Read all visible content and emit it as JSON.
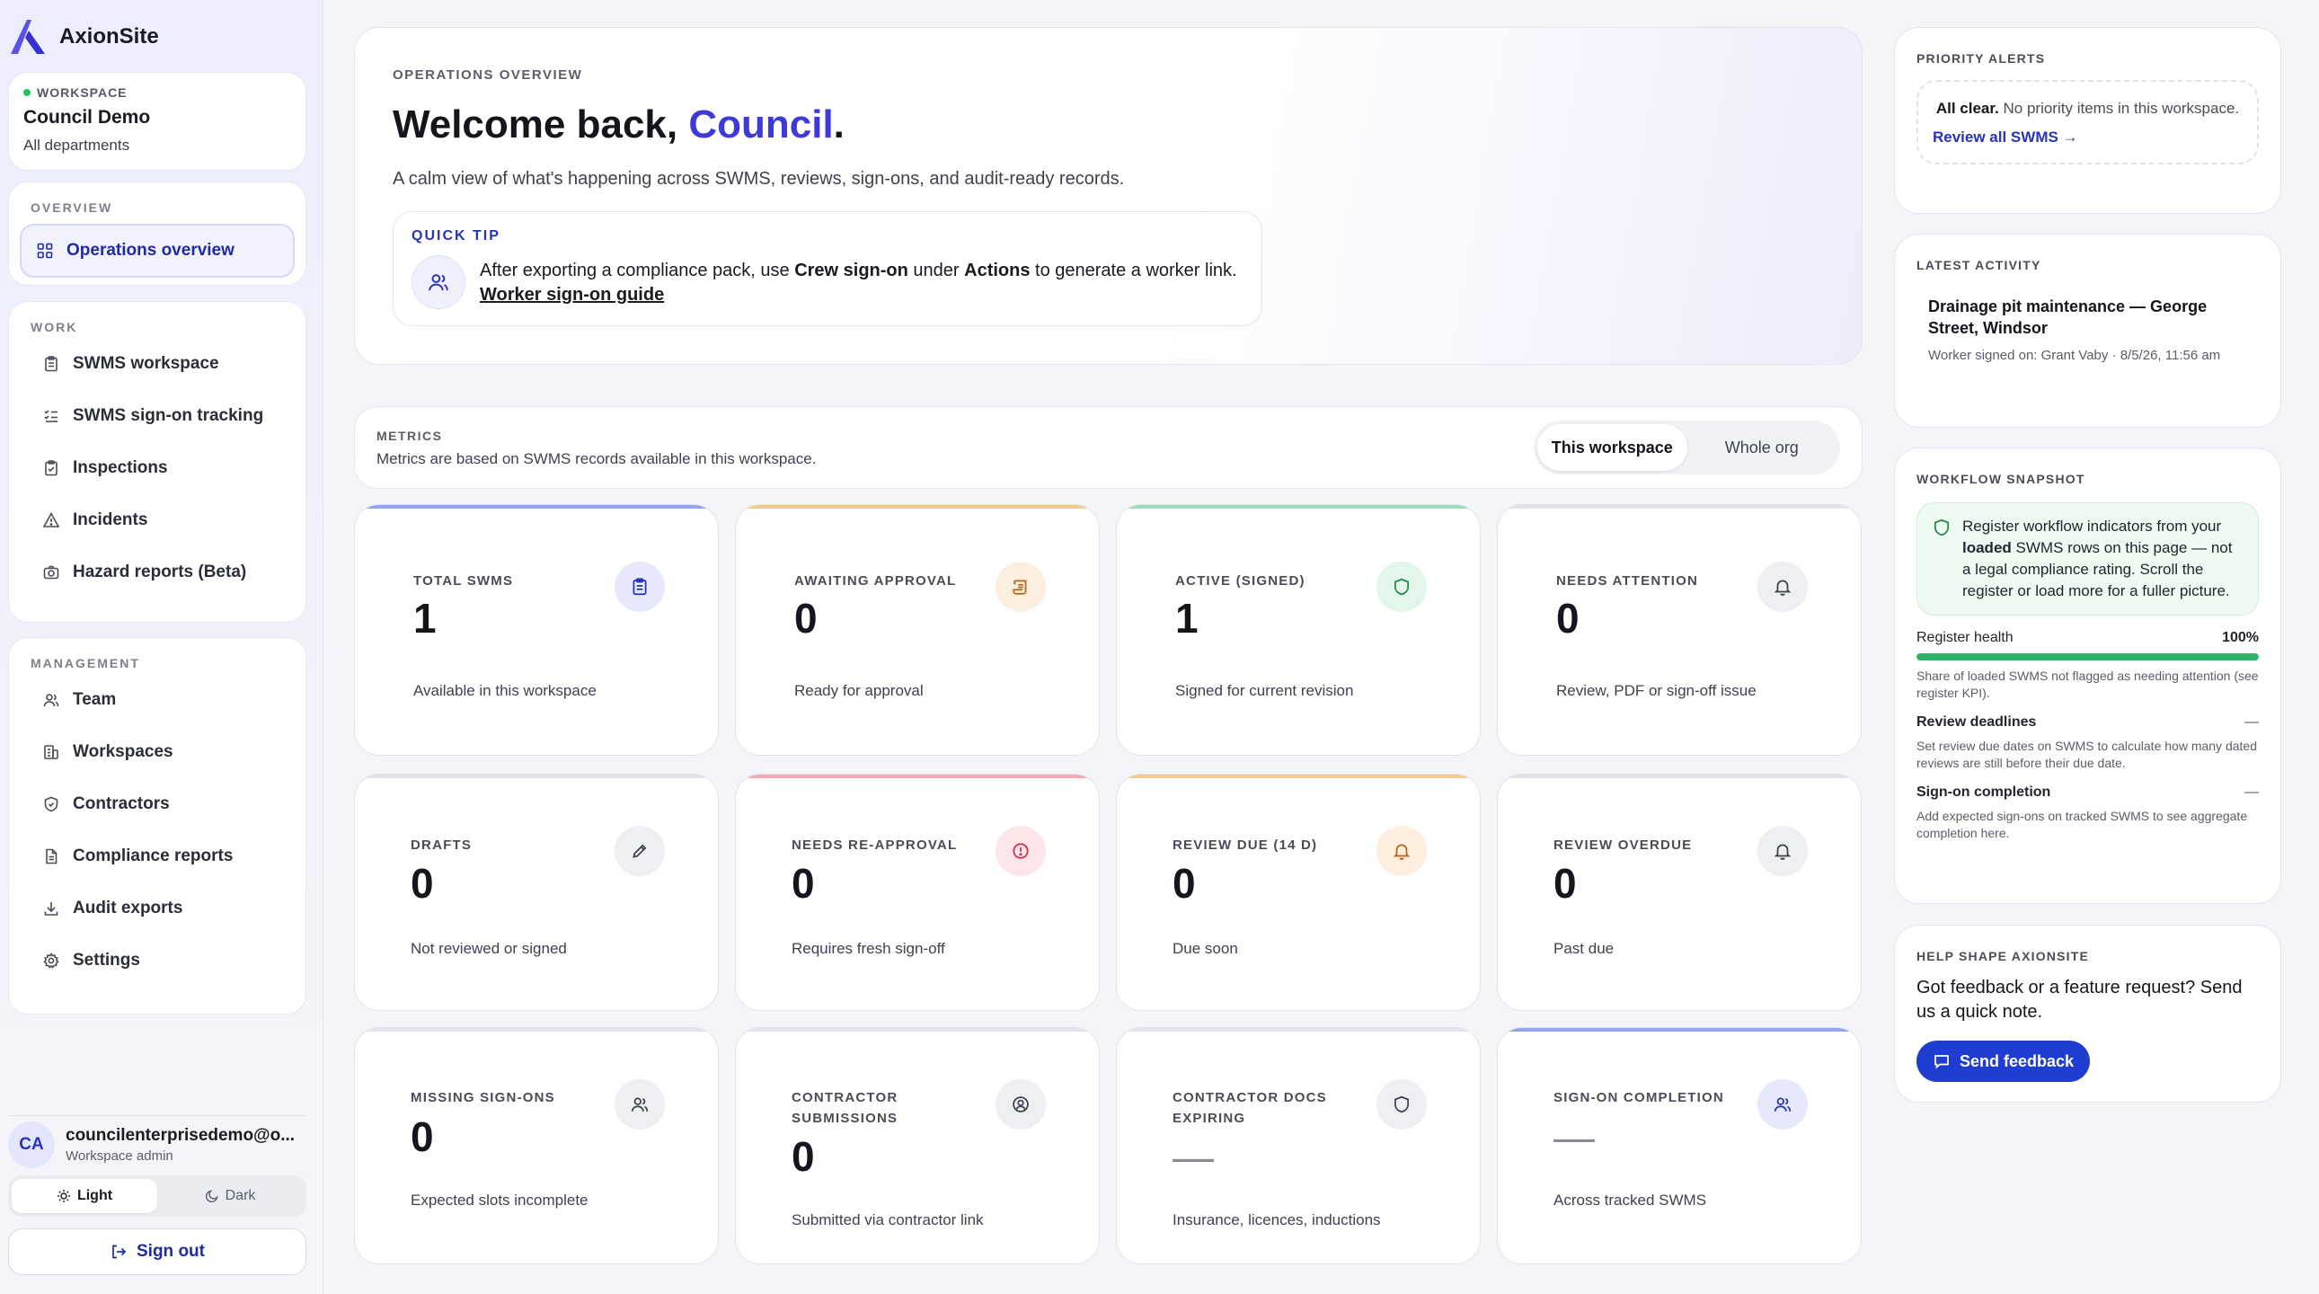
{
  "brand": {
    "name": "AxionSite"
  },
  "workspace": {
    "tag": "WORKSPACE",
    "name": "Council Demo",
    "scope": "All departments"
  },
  "nav": {
    "overview": {
      "heading": "OVERVIEW",
      "items": [
        {
          "label": "Operations overview",
          "icon": "grid-icon"
        }
      ]
    },
    "work": {
      "heading": "WORK",
      "items": [
        {
          "label": "SWMS workspace",
          "icon": "clipboard-icon"
        },
        {
          "label": "SWMS sign-on tracking",
          "icon": "list-check-icon"
        },
        {
          "label": "Inspections",
          "icon": "clipboard-check-icon"
        },
        {
          "label": "Incidents",
          "icon": "warning-icon"
        },
        {
          "label": "Hazard reports (Beta)",
          "icon": "camera-icon"
        }
      ]
    },
    "management": {
      "heading": "MANAGEMENT",
      "items": [
        {
          "label": "Team",
          "icon": "users-icon"
        },
        {
          "label": "Workspaces",
          "icon": "building-icon"
        },
        {
          "label": "Contractors",
          "icon": "badge-icon"
        },
        {
          "label": "Compliance reports",
          "icon": "document-icon"
        },
        {
          "label": "Audit exports",
          "icon": "download-icon"
        },
        {
          "label": "Settings",
          "icon": "gear-icon"
        }
      ]
    }
  },
  "user": {
    "initials": "CA",
    "email": "councilenterprisedemo@o...",
    "role": "Workspace admin"
  },
  "theme": {
    "light": "Light",
    "dark": "Dark",
    "selected": "Light"
  },
  "signout": {
    "label": "Sign out"
  },
  "hero": {
    "eyebrow": "OPERATIONS OVERVIEW",
    "title_prefix": "Welcome back, ",
    "title_name": "Council",
    "title_suffix": ".",
    "subtitle": "A calm view of what's happening across SWMS, reviews, sign-ons, and audit-ready records.",
    "tip": {
      "heading": "QUICK TIP",
      "t1": "After exporting a compliance pack, use ",
      "b1": "Crew sign-on",
      "t2": " under ",
      "b2": "Actions",
      "t3": " to generate a worker link. ",
      "link": "Worker sign-on guide"
    }
  },
  "metrics": {
    "heading": "METRICS",
    "subtitle": "Metrics are based on SWMS records available in this workspace.",
    "scope_options": [
      "This workspace",
      "Whole org"
    ],
    "scope_selected": "This workspace",
    "cards": [
      {
        "label": "TOTAL SWMS",
        "value": "1",
        "note": "Available in this workspace",
        "icon": "clipboard-icon",
        "accent": "#93a4f0",
        "icon_bg": "#e6e9fb",
        "icon_color": "#2734b7"
      },
      {
        "label": "AWAITING APPROVAL",
        "value": "0",
        "note": "Ready for approval",
        "icon": "scroll-icon",
        "accent": "#f3c98d",
        "icon_bg": "#fcefdf",
        "icon_color": "#b5651d"
      },
      {
        "label": "ACTIVE (SIGNED)",
        "value": "1",
        "note": "Signed for current revision",
        "icon": "shield-icon",
        "accent": "#9fdcba",
        "icon_bg": "#e3f6ea",
        "icon_color": "#1f8a4c"
      },
      {
        "label": "NEEDS ATTENTION",
        "value": "0",
        "note": "Review, PDF or sign-off issue",
        "icon": "bell-icon",
        "accent": "#e2e3ea",
        "icon_bg": "#eeeff3",
        "icon_color": "#3f4150"
      },
      {
        "label": "DRAFTS",
        "value": "0",
        "note": "Not reviewed or signed",
        "icon": "pencil-icon",
        "accent": "#e2e3ea",
        "icon_bg": "#eeeff3",
        "icon_color": "#3f4150"
      },
      {
        "label": "NEEDS RE-APPROVAL",
        "value": "0",
        "note": "Requires fresh sign-off",
        "icon": "alert-circle-icon",
        "accent": "#f2a7b5",
        "icon_bg": "#fde6ea",
        "icon_color": "#d6284a"
      },
      {
        "label": "REVIEW DUE (14 D)",
        "value": "0",
        "note": "Due soon",
        "icon": "bell-icon",
        "accent": "#f3c98d",
        "icon_bg": "#fcefdf",
        "icon_color": "#b5651d"
      },
      {
        "label": "REVIEW OVERDUE",
        "value": "0",
        "note": "Past due",
        "icon": "bell-icon",
        "accent": "#e2e3ea",
        "icon_bg": "#eeeff3",
        "icon_color": "#3f4150"
      },
      {
        "label": "MISSING SIGN-ONS",
        "value": "0",
        "note": "Expected slots incomplete",
        "icon": "users-icon",
        "accent": "#e2e3ea",
        "icon_bg": "#eeeff3",
        "icon_color": "#3f4150"
      },
      {
        "label": "CONTRACTOR SUBMISSIONS",
        "value": "0",
        "note": "Submitted via contractor link",
        "icon": "user-circle-icon",
        "accent": "#e2e3ea",
        "icon_bg": "#eeeff3",
        "icon_color": "#3f4150"
      },
      {
        "label": "CONTRACTOR DOCS EXPIRING",
        "value": "—",
        "note": "Insurance, licences, inductions",
        "icon": "shield-icon",
        "accent": "#e2e3ea",
        "icon_bg": "#eeeff3",
        "icon_color": "#3f4150"
      },
      {
        "label": "SIGN-ON COMPLETION",
        "value": "—",
        "note": "Across tracked SWMS",
        "icon": "users-icon",
        "accent": "#93a4f0",
        "icon_bg": "#e6e9fb",
        "icon_color": "#2734b7"
      }
    ]
  },
  "alerts": {
    "heading": "PRIORITY ALERTS",
    "bold": "All clear.",
    "text": " No priority items in this workspace.",
    "link": "Review all SWMS →"
  },
  "activity": {
    "heading": "LATEST ACTIVITY",
    "title": "Drainage pit maintenance — George Street, Windsor",
    "meta": "Worker signed on: Grant Vaby · 8/5/26, 11:56 am"
  },
  "snapshot": {
    "heading": "WORKFLOW SNAPSHOT",
    "info_a": "Register workflow indicators from your ",
    "info_b": "loaded",
    "info_c": " SWMS rows on this page — not a legal compliance rating. Scroll the register or load more for a fuller picture.",
    "health_label": "Register health",
    "health_value": "100%",
    "health_fraction": 1.0,
    "health_note": "Share of loaded SWMS not flagged as needing attention (see register KPI).",
    "deadlines_label": "Review deadlines",
    "deadlines_value": "—",
    "deadlines_note": "Set review due dates on SWMS to calculate how many dated reviews are still before their due date.",
    "signon_label": "Sign-on completion",
    "signon_value": "—",
    "signon_note": "Add expected sign-ons on tracked SWMS to see aggregate completion here."
  },
  "feedback": {
    "heading": "HELP SHAPE AXIONSITE",
    "text": "Got feedback or a feature request? Send us a quick note.",
    "button": "Send feedback"
  },
  "colors": {
    "accent": "#3d3ad8",
    "primary_button": "#1f3ed1",
    "success": "#2fb36b"
  }
}
